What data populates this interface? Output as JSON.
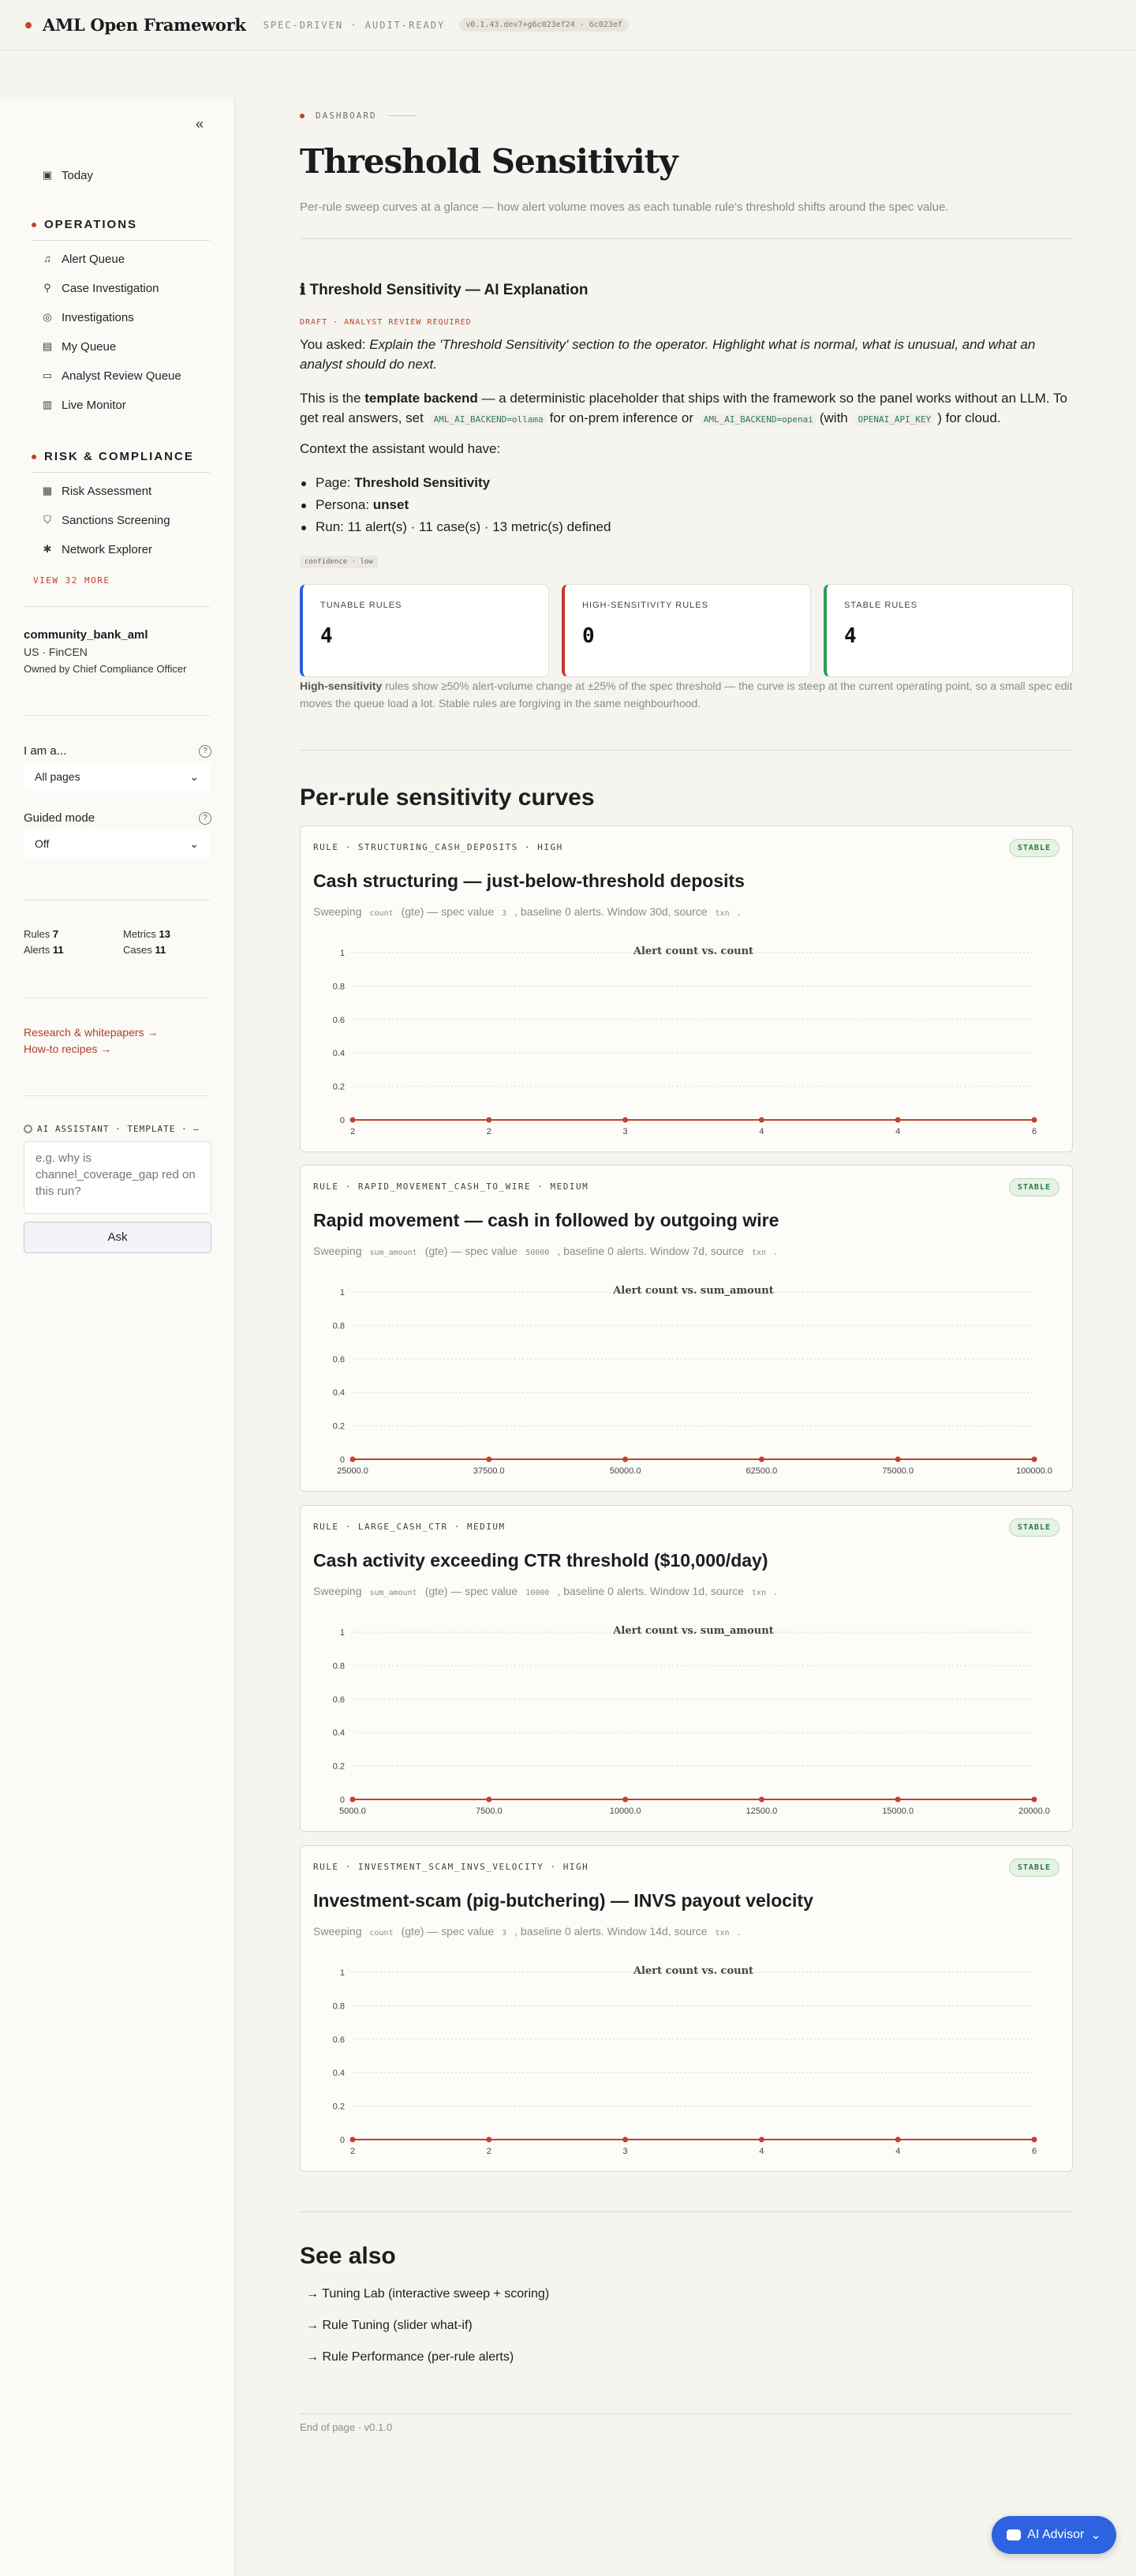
{
  "topbar": {
    "brand": "AML Open Framework",
    "tagline": "SPEC-DRIVEN · AUDIT-READY",
    "version": "v0.1.43.dev7+g6c023ef24 · 6c023ef"
  },
  "sidebar": {
    "collapse_icon": "«",
    "today": "Today",
    "operations": {
      "title": "OPERATIONS",
      "items": [
        "Alert Queue",
        "Case Investigation",
        "Investigations",
        "My Queue",
        "Analyst Review Queue",
        "Live Monitor"
      ]
    },
    "risk": {
      "title": "RISK & COMPLIANCE",
      "items": [
        "Risk Assessment",
        "Sanctions Screening",
        "Network Explorer"
      ]
    },
    "view_more": "VIEW 32 MORE",
    "tenant": {
      "name": "community_bank_aml",
      "region": "US · FinCEN",
      "owner": "Owned by Chief Compliance Officer"
    },
    "persona": {
      "label": "I am a...",
      "value": "All pages"
    },
    "guided": {
      "label": "Guided mode",
      "value": "Off"
    },
    "stats": {
      "rules_label": "Rules",
      "rules": "7",
      "metrics_label": "Metrics",
      "metrics": "13",
      "alerts_label": "Alerts",
      "alerts": "11",
      "cases_label": "Cases",
      "cases": "11"
    },
    "links": [
      "Research & whitepapers →",
      "How-to recipes →"
    ],
    "ai": {
      "header": "AI ASSISTANT · TEMPLATE · —",
      "placeholder": "e.g. why is channel_coverage_gap red on this run?",
      "ask": "Ask"
    }
  },
  "main": {
    "crumb": "DASHBOARD",
    "title": "Threshold Sensitivity",
    "lede": "Per-rule sweep curves at a glance — how alert volume moves as each tunable rule's threshold shifts around the spec value.",
    "expl": {
      "title": "ℹ Threshold Sensitivity — AI Explanation",
      "draft": "DRAFT · ANALYST REVIEW REQUIRED",
      "asked_prefix": "You asked: ",
      "asked": "Explain the 'Threshold Sensitivity' section to the operator. Highlight what is normal, what is unusual, and what an analyst should do next.",
      "p1a": "This is the ",
      "p1b": "template backend",
      "p1c": " — a deterministic placeholder that ships with the framework so the panel works without an LLM. To get real answers, set",
      "code1": "AML_AI_BACKEND=ollama",
      "p1d": "for on-prem inference or",
      "code2": "AML_AI_BACKEND=openai",
      "p1e": "(with",
      "code3": "OPENAI_API_KEY",
      "p1f": ") for cloud.",
      "context": "Context the assistant would have:",
      "items": [
        {
          "k": "Page: ",
          "v": "Threshold Sensitivity"
        },
        {
          "k": "Persona: ",
          "v": "unset"
        },
        {
          "k": "Run: 11 alert(s) · 11 case(s) · 13 metric(s) defined",
          "v": ""
        }
      ],
      "confidence": "confidence · low"
    },
    "cards": [
      {
        "label": "TUNABLE RULES",
        "value": "4",
        "color": "#2b5fd9"
      },
      {
        "label": "HIGH-SENSITIVITY RULES",
        "value": "0",
        "color": "#c43a2e"
      },
      {
        "label": "STABLE RULES",
        "value": "4",
        "color": "#2e9a52"
      }
    ],
    "note_b1": "High-sensitivity",
    "note_1": " rules show ≥50% alert-volume change at ±25% of the spec threshold — the curve is steep at the current operating point, so a small spec edit moves the queue load a lot. Stable rules are forgiving in the same neighbourhood.",
    "curves_title": "Per-rule sensitivity curves",
    "rules": [
      {
        "id": "RULE · STRUCTURING_CASH_DEPOSITS · HIGH",
        "badge": "STABLE",
        "title": "Cash structuring — just-below-threshold deposits",
        "s1": "Sweeping",
        "param": "count",
        "s2": "(gte) — spec value",
        "spec": "3",
        "s3": ", baseline 0 alerts. Window 30d, source",
        "source": "txn",
        "s4": ".",
        "chart_title": "Alert count vs. count",
        "x": [
          "2",
          "2",
          "3",
          "4",
          "4",
          "6"
        ]
      },
      {
        "id": "RULE · RAPID_MOVEMENT_CASH_TO_WIRE · MEDIUM",
        "badge": "STABLE",
        "title": "Rapid movement — cash in followed by outgoing wire",
        "s1": "Sweeping",
        "param": "sum_amount",
        "s2": "(gte) — spec value",
        "spec": "50000",
        "s3": ", baseline 0 alerts. Window 7d, source",
        "source": "txn",
        "s4": ".",
        "chart_title": "Alert count vs. sum_amount",
        "x": [
          "25000.0",
          "37500.0",
          "50000.0",
          "62500.0",
          "75000.0",
          "100000.0"
        ]
      },
      {
        "id": "RULE · LARGE_CASH_CTR · MEDIUM",
        "badge": "STABLE",
        "title": "Cash activity exceeding CTR threshold ($10,000/day)",
        "s1": "Sweeping",
        "param": "sum_amount",
        "s2": "(gte) — spec value",
        "spec": "10000",
        "s3": ", baseline 0 alerts. Window 1d, source",
        "source": "txn",
        "s4": ".",
        "chart_title": "Alert count vs. sum_amount",
        "x": [
          "5000.0",
          "7500.0",
          "10000.0",
          "12500.0",
          "15000.0",
          "20000.0"
        ]
      },
      {
        "id": "RULE · INVESTMENT_SCAM_INVS_VELOCITY · HIGH",
        "badge": "STABLE",
        "title": "Investment-scam (pig-butchering) — INVS payout velocity",
        "s1": "Sweeping",
        "param": "count",
        "s2": "(gte) — spec value",
        "spec": "3",
        "s3": ", baseline 0 alerts. Window 14d, source",
        "source": "txn",
        "s4": ".",
        "chart_title": "Alert count vs. count",
        "x": [
          "2",
          "2",
          "3",
          "4",
          "4",
          "6"
        ]
      }
    ],
    "yticks": [
      "1",
      "0.8",
      "0.6",
      "0.4",
      "0.2",
      "0"
    ],
    "see_also": {
      "title": "See also",
      "items": [
        "→ Tuning Lab (interactive sweep + scoring)",
        "→ Rule Tuning (slider what-if)",
        "→ Rule Performance (per-rule alerts)"
      ]
    },
    "footer": "End of page · v0.1.0"
  },
  "chart_data": [
    {
      "type": "line",
      "title": "Alert count vs. count",
      "x": [
        "2",
        "2",
        "3",
        "4",
        "4",
        "6"
      ],
      "series": [
        {
          "values": [
            0,
            0,
            0,
            0,
            0,
            0
          ]
        }
      ],
      "ylim": [
        0,
        1
      ]
    },
    {
      "type": "line",
      "title": "Alert count vs. sum_amount",
      "x": [
        25000,
        37500,
        50000,
        62500,
        75000,
        100000
      ],
      "series": [
        {
          "values": [
            0,
            0,
            0,
            0,
            0,
            0
          ]
        }
      ],
      "ylim": [
        0,
        1
      ]
    },
    {
      "type": "line",
      "title": "Alert count vs. sum_amount",
      "x": [
        5000,
        7500,
        10000,
        12500,
        15000,
        20000
      ],
      "series": [
        {
          "values": [
            0,
            0,
            0,
            0,
            0,
            0
          ]
        }
      ],
      "ylim": [
        0,
        1
      ]
    },
    {
      "type": "line",
      "title": "Alert count vs. count",
      "x": [
        "2",
        "2",
        "3",
        "4",
        "4",
        "6"
      ],
      "series": [
        {
          "values": [
            0,
            0,
            0,
            0,
            0,
            0
          ]
        }
      ],
      "ylim": [
        0,
        1
      ]
    }
  ],
  "fab": {
    "label": "AI Advisor",
    "chevron": "⌄"
  }
}
